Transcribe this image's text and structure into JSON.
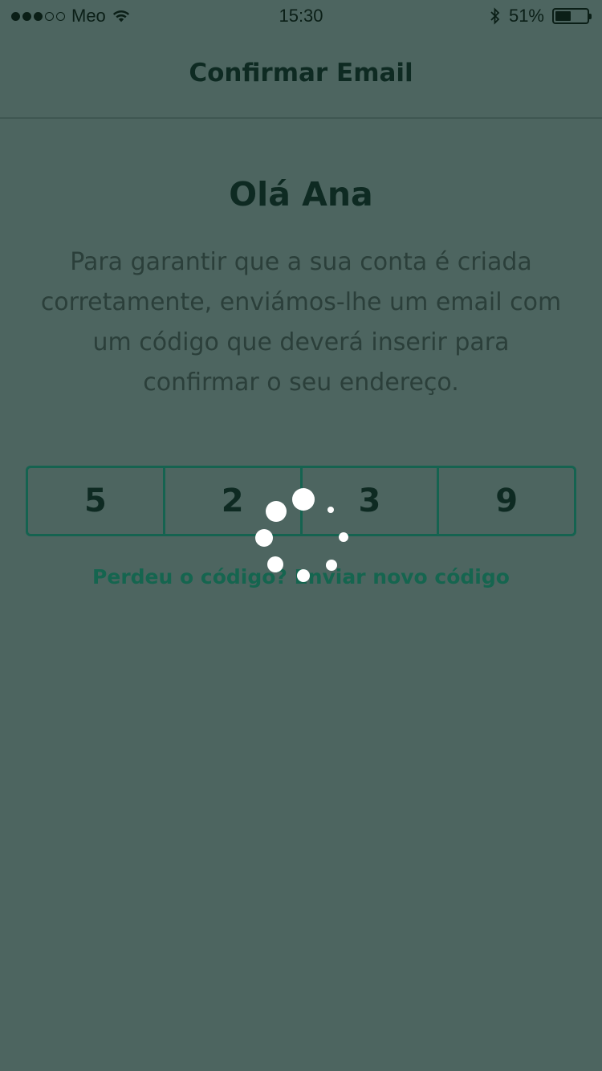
{
  "status_bar": {
    "carrier": "Meo",
    "time": "15:30",
    "battery": "51%",
    "battery_level": 0.51,
    "signal_strength": 3,
    "signal_max": 5
  },
  "nav": {
    "title": "Confirmar Email"
  },
  "greeting": "Olá Ana",
  "description": "Para garantir que a sua conta é criada corretamente, enviámos-lhe um email com um código que deverá inserir para confirmar o seu endereço.",
  "code": {
    "digits": [
      "5",
      "2",
      "3",
      "9"
    ]
  },
  "resend_link": "Perdeu o código? Enviar novo código",
  "colors": {
    "background": "#4d6560",
    "accent": "#156350",
    "text_dark": "#0e2a22"
  },
  "icons": [
    "signal-dots-icon",
    "wifi-icon",
    "bluetooth-icon",
    "battery-icon",
    "loading-spinner-icon"
  ]
}
